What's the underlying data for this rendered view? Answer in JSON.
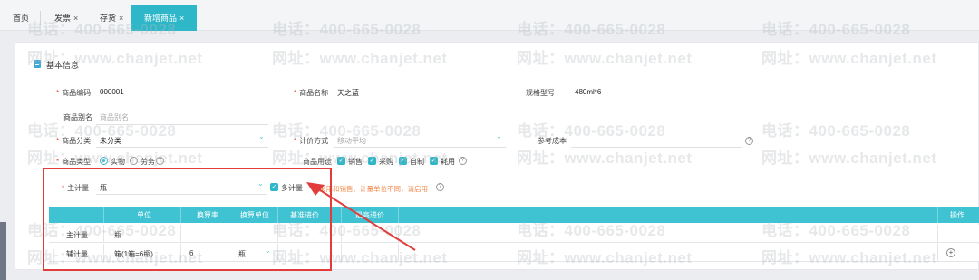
{
  "tabs": [
    {
      "label": "首页",
      "closable": false
    },
    {
      "label": "发票",
      "closable": true
    },
    {
      "label": "存货",
      "closable": true
    },
    {
      "label": "新增商品",
      "closable": true
    }
  ],
  "close_glyph": "×",
  "section": {
    "title": "基本信息"
  },
  "form": {
    "code": {
      "label": "商品编码",
      "value": "000001"
    },
    "name": {
      "label": "商品名称",
      "value": "天之蓝"
    },
    "spec": {
      "label": "规格型号",
      "value": "480ml*6"
    },
    "alias": {
      "label": "商品别名",
      "placeholder": "商品别名"
    },
    "category": {
      "label": "商品分类",
      "value": "未分类"
    },
    "pricing": {
      "label": "计价方式",
      "value": "移动平均"
    },
    "ref_cost": {
      "label": "参考成本"
    },
    "type": {
      "label": "商品类型",
      "options": [
        "实物",
        "劳务"
      ],
      "selected": "实物"
    },
    "usage": {
      "label": "商品用途",
      "options": [
        "销售",
        "采购",
        "自制",
        "耗用"
      ]
    },
    "main_unit": {
      "label": "主计量",
      "value": "瓶"
    },
    "multi_unit": {
      "label": "多计量",
      "checked": true
    },
    "multi_unit_hint": "采用和销售、计量单位不同，请启用"
  },
  "table": {
    "headers": [
      "单位",
      "换算率",
      "换算单位",
      "基准进价",
      "最高进价",
      "操作"
    ],
    "rows": [
      {
        "type": "主计量",
        "unit": "瓶",
        "rate": "",
        "conv_unit": ""
      },
      {
        "type": "辅计量",
        "unit": "箱(1箱=6瓶)",
        "rate": "6",
        "conv_unit": "瓶"
      }
    ]
  },
  "watermark": {
    "phone": "电话：400-665-0028",
    "site": "网址：www.chanjet.net"
  },
  "icons": {
    "check": "✓",
    "chevron": "⌄",
    "question": "?",
    "plus": "+"
  },
  "colors": {
    "accent": "#2db7c9",
    "annotation": "#e23c3c",
    "required": "#e84b3c",
    "hint": "#f08a4b"
  }
}
